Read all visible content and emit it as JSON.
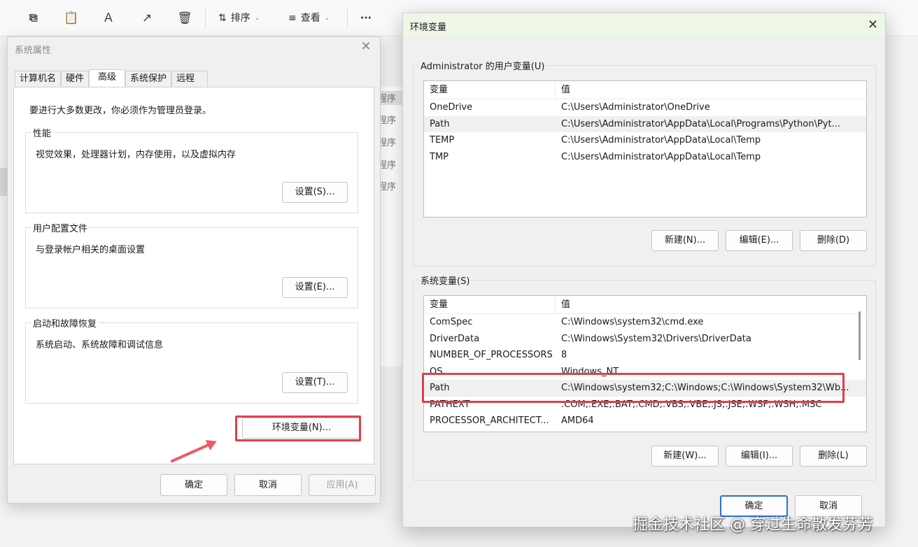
{
  "toolbar": {
    "sort_label": "排序",
    "view_label": "查看",
    "more_label": "···"
  },
  "background_rows": [
    "程序",
    "程序",
    "程序",
    "程序",
    "程序"
  ],
  "sysprops": {
    "title": "系统属性",
    "tabs": [
      "计算机名",
      "硬件",
      "高级",
      "系统保护",
      "远程"
    ],
    "active_tab": "高级",
    "note": "要进行大多数更改，你必须作为管理员登录。",
    "groups": [
      {
        "label": "性能",
        "desc": "视觉效果，处理器计划，内存使用，以及虚拟内存",
        "button": "设置(S)..."
      },
      {
        "label": "用户配置文件",
        "desc": "与登录帐户相关的桌面设置",
        "button": "设置(E)..."
      },
      {
        "label": "启动和故障恢复",
        "desc": "系统启动、系统故障和调试信息",
        "button": "设置(T)..."
      }
    ],
    "env_button": "环境变量(N)...",
    "ok": "确定",
    "cancel": "取消",
    "apply": "应用(A)"
  },
  "env": {
    "title": "环境变量",
    "user_section": "Administrator 的用户变量(U)",
    "columns": [
      "变量",
      "值"
    ],
    "user_vars": [
      {
        "name": "OneDrive",
        "value": "C:\\Users\\Administrator\\OneDrive"
      },
      {
        "name": "Path",
        "value": "C:\\Users\\Administrator\\AppData\\Local\\Programs\\Python\\Pyt..."
      },
      {
        "name": "TEMP",
        "value": "C:\\Users\\Administrator\\AppData\\Local\\Temp"
      },
      {
        "name": "TMP",
        "value": "C:\\Users\\Administrator\\AppData\\Local\\Temp"
      }
    ],
    "user_buttons": {
      "new": "新建(N)...",
      "edit": "编辑(E)...",
      "delete": "删除(D)"
    },
    "system_section": "系统变量(S)",
    "system_vars": [
      {
        "name": "ComSpec",
        "value": "C:\\Windows\\system32\\cmd.exe"
      },
      {
        "name": "DriverData",
        "value": "C:\\Windows\\System32\\Drivers\\DriverData"
      },
      {
        "name": "NUMBER_OF_PROCESSORS",
        "value": "8"
      },
      {
        "name": "OS",
        "value": "Windows_NT"
      },
      {
        "name": "Path",
        "value": "C:\\Windows\\system32;C:\\Windows;C:\\Windows\\System32\\Wb..."
      },
      {
        "name": "PATHEXT",
        "value": ".COM;.EXE;.BAT;.CMD;.VBS;.VBE;.JS;.JSE;.WSF;.WSH;.MSC"
      },
      {
        "name": "PROCESSOR_ARCHITECT...",
        "value": "AMD64"
      }
    ],
    "system_buttons": {
      "new": "新建(W)...",
      "edit": "编辑(I)...",
      "delete": "删除(L)"
    },
    "ok": "确定",
    "cancel": "取消"
  },
  "watermark": "掘金技术社区 @ 穿过生命散发芬芳",
  "colors": {
    "highlight_box": "#e0404a",
    "arrow": "#ef5a63",
    "env_titlebar": "#eef6e6"
  }
}
